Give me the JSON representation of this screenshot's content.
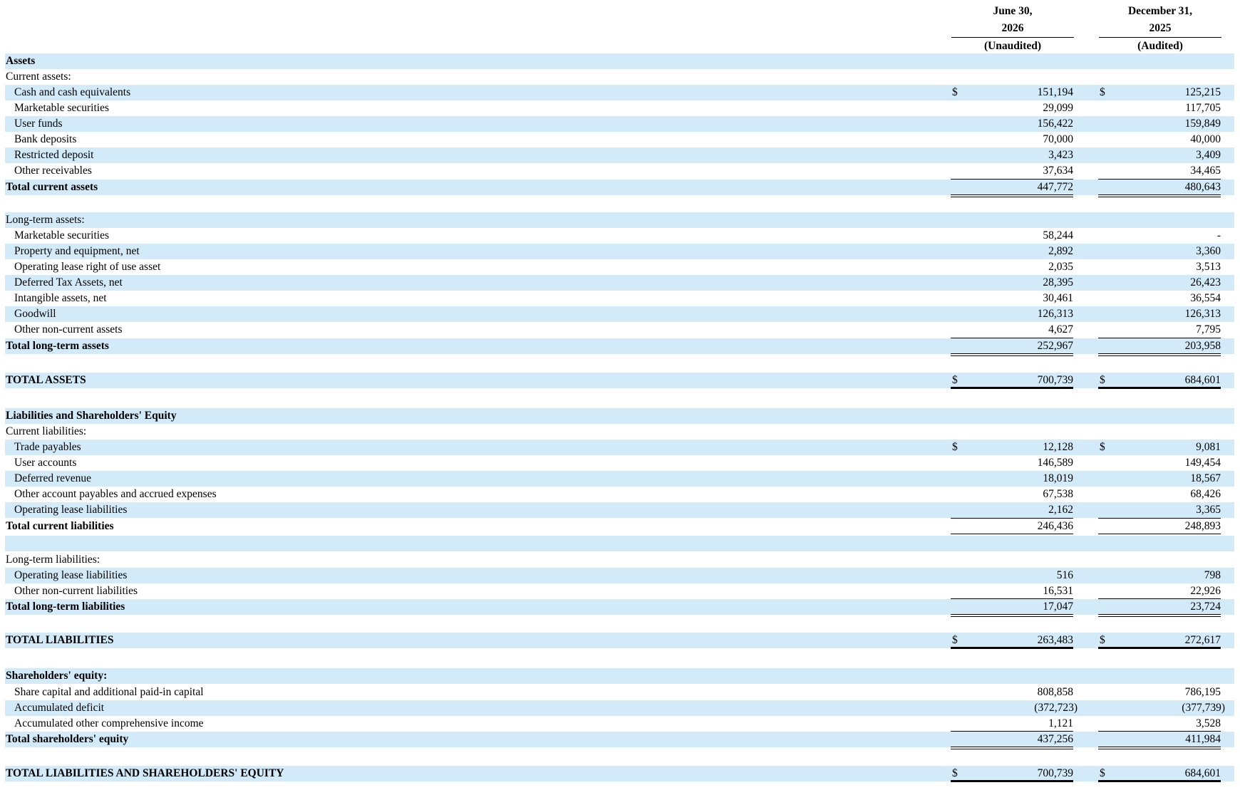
{
  "columns": [
    {
      "line1": "June 30,",
      "line2": "2026",
      "line3": "(Unaudited)"
    },
    {
      "line1": "December 31,",
      "line2": "2025",
      "line3": "(Audited)"
    }
  ],
  "currency_symbol": "$",
  "rows": [
    {
      "label": "Assets",
      "bold": true,
      "indent": false
    },
    {
      "label": "Current assets:",
      "bold": false,
      "indent": false
    },
    {
      "label": "Cash and cash equivalents",
      "indent": true,
      "dollar": true,
      "v1": "151,194",
      "v2": "125,215"
    },
    {
      "label": "Marketable securities",
      "indent": true,
      "v1": "29,099",
      "v2": "117,705"
    },
    {
      "label": "User funds",
      "indent": true,
      "v1": "156,422",
      "v2": "159,849"
    },
    {
      "label": "Bank deposits",
      "indent": true,
      "v1": "70,000",
      "v2": "40,000"
    },
    {
      "label": "Restricted deposit",
      "indent": true,
      "v1": "3,423",
      "v2": "3,409"
    },
    {
      "label": "Other receivables",
      "indent": true,
      "v1": "37,634",
      "v2": "34,465"
    },
    {
      "label": "Total current assets",
      "bold": true,
      "v1": "447,772",
      "v2": "480,643",
      "total": "double"
    },
    {
      "label": ""
    },
    {
      "label": "Long-term assets:"
    },
    {
      "label": "Marketable securities",
      "indent": true,
      "v1": "58,244",
      "v2": "-"
    },
    {
      "label": "Property and equipment, net",
      "indent": true,
      "v1": "2,892",
      "v2": "3,360"
    },
    {
      "label": "Operating lease right of use asset",
      "indent": true,
      "v1": "2,035",
      "v2": "3,513"
    },
    {
      "label": "Deferred Tax Assets, net",
      "indent": true,
      "v1": "28,395",
      "v2": "26,423"
    },
    {
      "label": "Intangible assets, net",
      "indent": true,
      "v1": "30,461",
      "v2": "36,554"
    },
    {
      "label": "Goodwill",
      "indent": true,
      "v1": "126,313",
      "v2": "126,313"
    },
    {
      "label": "Other non-current assets",
      "indent": true,
      "v1": "4,627",
      "v2": "7,795"
    },
    {
      "label": "Total long-term assets",
      "bold": true,
      "v1": "252,967",
      "v2": "203,958",
      "total": "double"
    },
    {
      "label": ""
    },
    {
      "label": "TOTAL ASSETS",
      "bold": true,
      "dollar": true,
      "v1": "700,739",
      "v2": "684,601",
      "total": "thick"
    },
    {
      "label": ""
    },
    {
      "label": "Liabilities and Shareholders' Equity",
      "bold": true
    },
    {
      "label": "Current liabilities:"
    },
    {
      "label": "Trade payables",
      "indent": true,
      "dollar": true,
      "v1": "12,128",
      "v2": "9,081"
    },
    {
      "label": "User accounts",
      "indent": true,
      "v1": "146,589",
      "v2": "149,454"
    },
    {
      "label": "Deferred revenue",
      "indent": true,
      "v1": "18,019",
      "v2": "18,567"
    },
    {
      "label": "Other account payables and accrued expenses",
      "indent": true,
      "v1": "67,538",
      "v2": "68,426"
    },
    {
      "label": "Operating lease liabilities",
      "indent": true,
      "v1": "2,162",
      "v2": "3,365"
    },
    {
      "label": "Total current liabilities",
      "bold": true,
      "v1": "246,436",
      "v2": "248,893",
      "total": "double"
    },
    {
      "label": ""
    },
    {
      "label": "Long-term liabilities:"
    },
    {
      "label": "Operating lease liabilities",
      "indent": true,
      "v1": "516",
      "v2": "798"
    },
    {
      "label": "Other non-current liabilities",
      "indent": true,
      "v1": "16,531",
      "v2": "22,926"
    },
    {
      "label": "Total long-term liabilities",
      "bold": true,
      "v1": "17,047",
      "v2": "23,724",
      "total": "double"
    },
    {
      "label": ""
    },
    {
      "label": "TOTAL LIABILITIES",
      "bold": true,
      "dollar": true,
      "v1": "263,483",
      "v2": "272,617",
      "total": "thick"
    },
    {
      "label": ""
    },
    {
      "label": "Shareholders' equity:",
      "bold": true
    },
    {
      "label": "Share capital and additional paid-in capital",
      "indent": true,
      "v1": "808,858",
      "v2": "786,195"
    },
    {
      "label": "Accumulated deficit",
      "indent": true,
      "v1": "(372,723)",
      "v2": "(377,739)",
      "paren": true
    },
    {
      "label": "Accumulated other comprehensive income",
      "indent": true,
      "v1": "1,121",
      "v2": "3,528"
    },
    {
      "label": "Total shareholders' equity",
      "bold": true,
      "v1": "437,256",
      "v2": "411,984",
      "total": "double"
    },
    {
      "label": ""
    },
    {
      "label": "TOTAL LIABILITIES AND SHAREHOLDERS' EQUITY",
      "bold": true,
      "dollar": true,
      "v1": "700,739",
      "v2": "684,601",
      "total": "thick"
    }
  ]
}
